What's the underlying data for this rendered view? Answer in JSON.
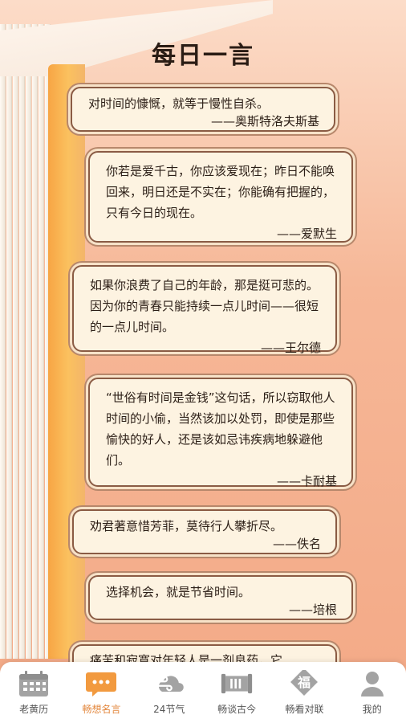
{
  "header": {
    "title": "每日一言"
  },
  "quotes": [
    {
      "text": "对时间的慷慨，就等于慢性自杀。",
      "author": "——奥斯特洛夫斯基"
    },
    {
      "text": "你若是爱千古，你应该爱现在；昨日不能唤回来，明日还是不实在；你能确有把握的，只有今日的现在。",
      "author": "——爱默生"
    },
    {
      "text": "如果你浪费了自己的年龄，那是挺可悲的。因为你的青春只能持续一点儿时间——很短的一点儿时间。",
      "author": "——王尔德"
    },
    {
      "text": "“世俗有时间是金钱”这句话，所以窃取他人时间的小偷，当然该加以处罚，即使是那些愉快的好人，还是该如忌讳疾病地躲避他们。",
      "author": "——卡耐基"
    },
    {
      "text": "劝君著意惜芳菲，莫待行人攀折尽。",
      "author": "——佚名"
    },
    {
      "text": "选择机会，就是节省时间。",
      "author": "——培根"
    },
    {
      "text": "痛苦和寂寞对年轻人是一剂良药，它",
      "author": ""
    }
  ],
  "tabbar": {
    "items": [
      {
        "label": "老黄历",
        "icon": "calendar-icon"
      },
      {
        "label": "畅想名言",
        "icon": "chat-icon"
      },
      {
        "label": "24节气",
        "icon": "cloud-wind-icon"
      },
      {
        "label": "畅谈古今",
        "icon": "scroll-icon"
      },
      {
        "label": "畅看对联",
        "icon": "fu-icon",
        "glyph": "福"
      },
      {
        "label": "我的",
        "icon": "user-icon"
      }
    ]
  },
  "colors": {
    "accent": "#f29a3f",
    "icon_gray": "#9a9a9a"
  }
}
